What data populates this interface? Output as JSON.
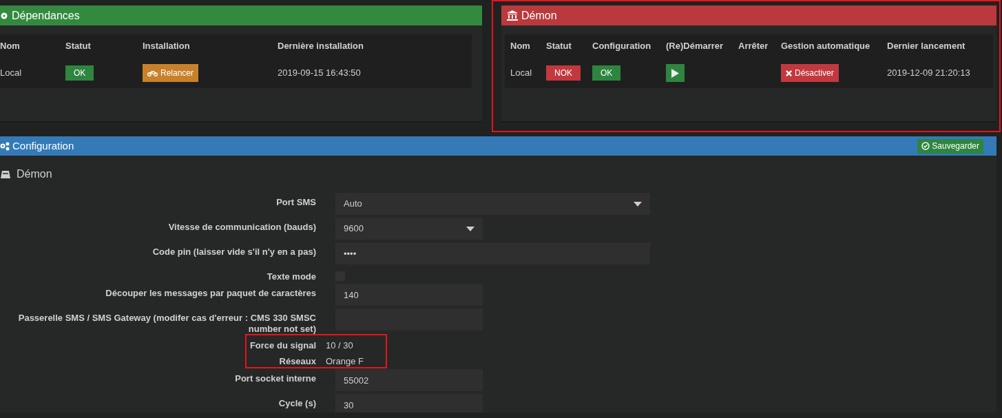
{
  "dependencies": {
    "title": "Dépendances",
    "columns": [
      "Nom",
      "Statut",
      "Installation",
      "Dernière installation"
    ],
    "rows": [
      [
        {
          "kind": "text",
          "text": "Local"
        },
        {
          "kind": "badge",
          "text": "OK",
          "color": "#2e8540"
        },
        {
          "kind": "button",
          "text": "Relancer",
          "color": "#c8812b"
        },
        {
          "kind": "text",
          "text": "2019-09-15 16:43:50"
        }
      ]
    ]
  },
  "daemon": {
    "title": "Démon",
    "highlighted": true,
    "columns": [
      "Nom",
      "Statut",
      "Configuration",
      "(Re)Démarrer",
      "Arrêter",
      "Gestion automatique",
      "Dernier lancement"
    ],
    "rows": [
      [
        {
          "kind": "text",
          "text": "Local"
        },
        {
          "kind": "badge",
          "text": "NOK",
          "color": "#c1393e"
        },
        {
          "kind": "badge",
          "text": "OK",
          "color": "#2e8540"
        },
        {
          "kind": "play"
        },
        {
          "kind": "empty"
        },
        {
          "kind": "cancel",
          "text": "Désactiver",
          "color": "#c1393e"
        },
        {
          "kind": "text",
          "text": "2019-12-09 21:20:13"
        }
      ]
    ]
  },
  "configuration": {
    "title": "Configuration",
    "save_button": "Sauvegarder",
    "section": "Démon",
    "fields": [
      {
        "kind": "select",
        "label": "Port SMS",
        "value": "Auto",
        "wide": true
      },
      {
        "kind": "select",
        "label": "Vitesse de communication (bauds)",
        "value": "9600",
        "wide": false
      },
      {
        "kind": "text",
        "label": "Code pin (laisser vide s'il n'y en a pas)",
        "value": "••••",
        "wide": true
      },
      {
        "kind": "checkbox",
        "label": "Texte mode",
        "checked": false
      },
      {
        "kind": "text",
        "label": "Découper les messages par paquet de caractères",
        "value": "140",
        "wide": false
      },
      {
        "kind": "text",
        "label": "Passerelle SMS / SMS Gateway (modifer cas d'erreur : CMS 330 SMSC number not set)",
        "wide": false
      },
      {
        "kind": "info",
        "label": "Force du signal",
        "value": "10 / 30",
        "highlighted": true
      },
      {
        "kind": "info",
        "label": "Réseaux",
        "value": "Orange F",
        "highlighted": true
      },
      {
        "kind": "text",
        "label": "Port socket interne",
        "value": "55002",
        "wide": false
      },
      {
        "kind": "text",
        "label": "Cycle (s)",
        "value": "30",
        "wide": false
      }
    ]
  }
}
